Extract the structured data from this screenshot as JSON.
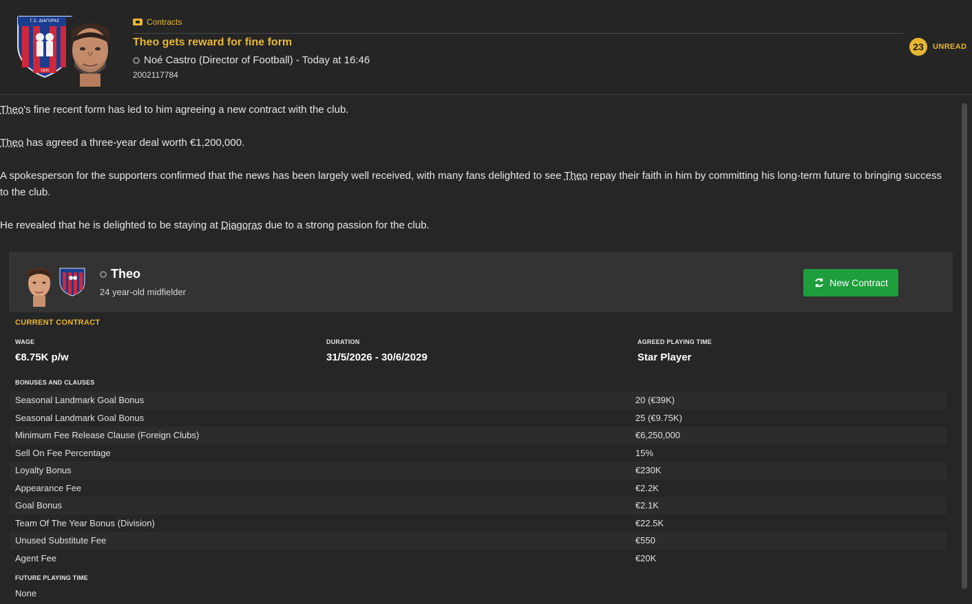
{
  "header": {
    "category": "Contracts",
    "title": "Theo gets reward for fine form",
    "sender": "Noé Castro (Director of Football) - Today at 16:46",
    "message_id": "2002117784",
    "unread_count": "23",
    "unread_label": "UNREAD",
    "crest_text_top": "Γ.Σ. ΔΙΑΓΟΡΑΣ",
    "crest_year": "1905"
  },
  "body": {
    "p1": {
      "name": "Theo",
      "rest": "'s fine recent form has led to him agreeing a new contract with the club."
    },
    "p2": {
      "name": "Theo",
      "rest": " has agreed a three-year deal worth €1,200,000."
    },
    "p3": {
      "before": "A spokesperson for the supporters confirmed that the news has been largely well received, with many fans delighted to see ",
      "name": "Theo",
      "after": " repay their faith in him by committing his long-term future to bringing success to the club."
    },
    "p4": {
      "before": "He revealed that he is delighted to be staying at ",
      "club": "Diagoras",
      "after": " due to a strong passion for the club."
    }
  },
  "player": {
    "name": "Theo",
    "description": "24 year-old midfielder",
    "button_label": "New Contract"
  },
  "contract": {
    "section_title": "CURRENT CONTRACT",
    "wage_label": "WAGE",
    "wage": "€8.75K p/w",
    "duration_label": "DURATION",
    "duration": "31/5/2026 - 30/6/2029",
    "playing_time_label": "AGREED PLAYING TIME",
    "playing_time": "Star Player",
    "bonuses_label": "BONUSES AND CLAUSES",
    "bonuses": [
      {
        "name": "Seasonal Landmark Goal Bonus",
        "value": "20 (€39K)"
      },
      {
        "name": "Seasonal Landmark Goal Bonus",
        "value": "25 (€9.75K)"
      },
      {
        "name": "Minimum Fee Release Clause (Foreign Clubs)",
        "value": "€6,250,000"
      },
      {
        "name": "Sell On Fee Percentage",
        "value": "15%"
      },
      {
        "name": "Loyalty Bonus",
        "value": "€230K"
      },
      {
        "name": "Appearance Fee",
        "value": "€2.2K"
      },
      {
        "name": "Goal Bonus",
        "value": "€2.1K"
      },
      {
        "name": "Team Of The Year Bonus (Division)",
        "value": "€22.5K"
      },
      {
        "name": "Unused Substitute Fee",
        "value": "€550"
      },
      {
        "name": "Agent Fee",
        "value": "€20K"
      }
    ],
    "future_label": "FUTURE PLAYING TIME",
    "future_value": "None"
  },
  "colors": {
    "accent": "#e8b731",
    "button_green": "#1f9e3d",
    "background": "#262626"
  }
}
